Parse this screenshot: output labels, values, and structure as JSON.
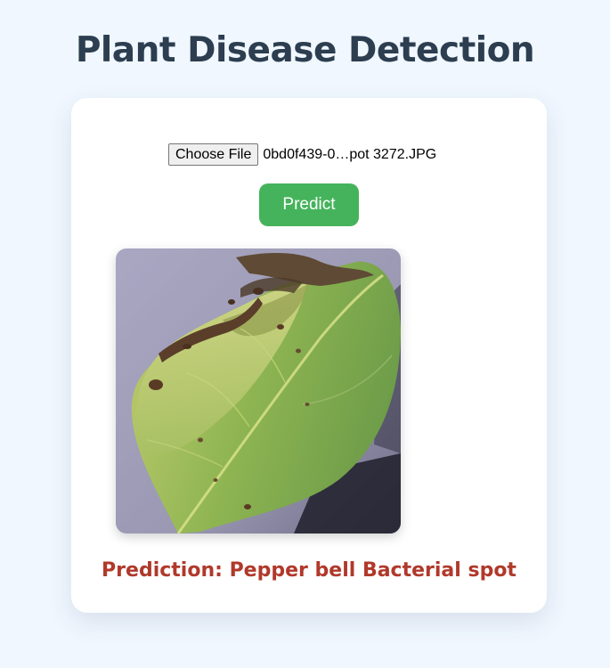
{
  "page": {
    "title": "Plant Disease Detection"
  },
  "upload": {
    "choose_file_label": "Choose File",
    "file_name": "0bd0f439-0…pot 3272.JPG"
  },
  "predict": {
    "button_label": "Predict"
  },
  "result": {
    "prediction_text": "Prediction: Pepper bell Bacterial spot"
  },
  "colors": {
    "background": "#f0f7ff",
    "title": "#2c3e50",
    "predict_button": "#45b35b",
    "prediction_text": "#b0392b"
  }
}
